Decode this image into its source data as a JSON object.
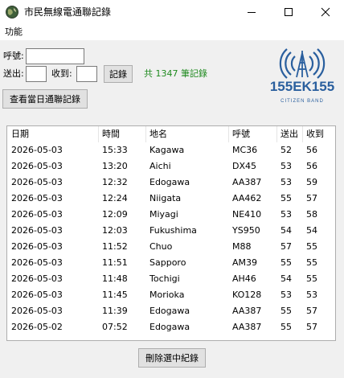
{
  "window": {
    "title": "市民無線電通聯記錄"
  },
  "menu": {
    "items": [
      "功能"
    ]
  },
  "form": {
    "callsign_label": "呼號:",
    "callsign_value": "",
    "sent_label": "送出:",
    "sent_value": "",
    "received_label": "收到:",
    "received_value": "",
    "record_button": "記錄",
    "count_text": "共 1347 筆記錄",
    "view_today_button": "查看當日通聯記錄"
  },
  "logo": {
    "text": "155EK155",
    "subtext": "CITIZEN BAND"
  },
  "log_table": {
    "columns": [
      "日期",
      "時間",
      "地名",
      "呼號",
      "送出",
      "收到"
    ],
    "rows": [
      [
        "2026-05-03",
        "15:33",
        "Kagawa",
        "MC36",
        "52",
        "56"
      ],
      [
        "2026-05-03",
        "13:20",
        "Aichi",
        "DX45",
        "53",
        "56"
      ],
      [
        "2026-05-03",
        "12:32",
        "Edogawa",
        "AA387",
        "53",
        "59"
      ],
      [
        "2026-05-03",
        "12:24",
        "Niigata",
        "AA462",
        "55",
        "57"
      ],
      [
        "2026-05-03",
        "12:09",
        "Miyagi",
        "NE410",
        "53",
        "58"
      ],
      [
        "2026-05-03",
        "12:03",
        "Fukushima",
        "YS950",
        "54",
        "54"
      ],
      [
        "2026-05-03",
        "11:52",
        "Chuo",
        "M88",
        "57",
        "55"
      ],
      [
        "2026-05-03",
        "11:51",
        "Sapporo",
        "AM39",
        "55",
        "55"
      ],
      [
        "2026-05-03",
        "11:48",
        "Tochigi",
        "AH46",
        "54",
        "55"
      ],
      [
        "2026-05-03",
        "11:45",
        "Morioka",
        "KO128",
        "53",
        "53"
      ],
      [
        "2026-05-03",
        "11:39",
        "Edogawa",
        "AA387",
        "55",
        "57"
      ],
      [
        "2026-05-02",
        "07:52",
        "Edogawa",
        "AA387",
        "55",
        "57"
      ]
    ]
  },
  "footer": {
    "delete_button": "刪除選中紀錄"
  },
  "colors": {
    "accent_green": "#1f8a1f",
    "logo_blue": "#2a5f9e"
  }
}
